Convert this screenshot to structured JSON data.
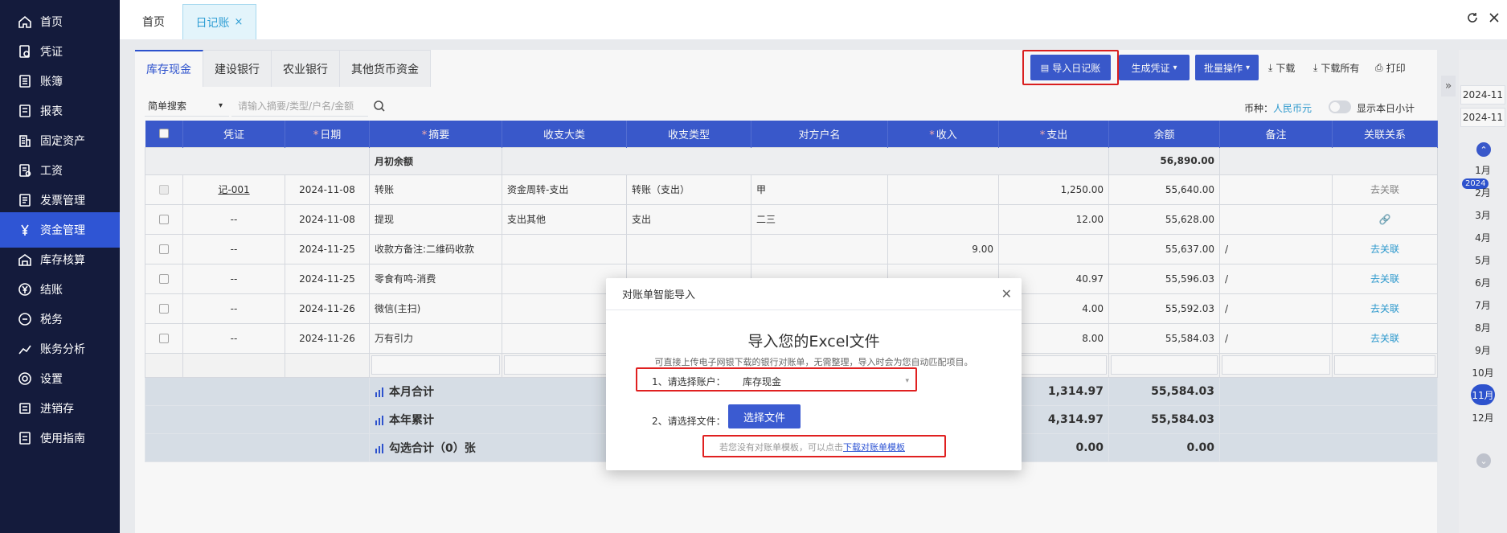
{
  "sidebar": {
    "items": [
      {
        "label": "首页",
        "icon": "home-icon"
      },
      {
        "label": "凭证",
        "icon": "voucher-icon"
      },
      {
        "label": "账簿",
        "icon": "ledger-icon"
      },
      {
        "label": "报表",
        "icon": "report-icon"
      },
      {
        "label": "固定资产",
        "icon": "building-icon"
      },
      {
        "label": "工资",
        "icon": "salary-icon"
      },
      {
        "label": "发票管理",
        "icon": "invoice-icon"
      },
      {
        "label": "资金管理",
        "icon": "yen-icon"
      },
      {
        "label": "库存核算",
        "icon": "warehouse-icon"
      },
      {
        "label": "结账",
        "icon": "yen-circle-icon"
      },
      {
        "label": "税务",
        "icon": "tax-icon"
      },
      {
        "label": "账务分析",
        "icon": "line-chart-icon"
      },
      {
        "label": "设置",
        "icon": "gear-icon"
      },
      {
        "label": "进销存",
        "icon": "inventory-icon"
      },
      {
        "label": "使用指南",
        "icon": "guide-icon"
      }
    ],
    "active_index": 7
  },
  "topbar": {
    "home_tab": "首页",
    "active_tab": "日记账",
    "close_glyph": "×"
  },
  "account_tabs": [
    "库存现金",
    "建设银行",
    "农业银行",
    "其他货币资金"
  ],
  "toolbar": {
    "import_label": "导入日记账",
    "generate_label": "生成凭证",
    "batch_label": "批量操作",
    "download_label": "下载",
    "download_all_label": "下载所有",
    "print_label": "打印"
  },
  "search": {
    "mode": "简单搜索",
    "placeholder": "请输入摘要/类型/户名/金额",
    "currency_label": "币种：",
    "currency_value": "人民币元",
    "daily_subtotal_label": "显示本日小计"
  },
  "table": {
    "headers": [
      "凭证",
      "日期",
      "摘要",
      "收支大类",
      "收支类型",
      "对方户名",
      "收入",
      "支出",
      "余额",
      "备注",
      "关联关系"
    ],
    "opening": {
      "label": "月初余额",
      "balance": "56,890.00"
    },
    "rows": [
      {
        "voucher": "记-001",
        "date": "2024-11-08",
        "summary": "转账",
        "category": "资金周转-支出",
        "type": "转账（支出）",
        "party": "甲",
        "income": "",
        "expense": "1,250.00",
        "balance": "55,640.00",
        "note": "",
        "relation": "去关联",
        "disabled": true
      },
      {
        "voucher": "--",
        "date": "2024-11-08",
        "summary": "提现",
        "category": "支出其他",
        "type": "支出",
        "party": "二三",
        "income": "",
        "expense": "12.00",
        "balance": "55,628.00",
        "note": "",
        "relation": "link-icon",
        "disabled": false
      },
      {
        "voucher": "--",
        "date": "2024-11-25",
        "summary": "收款方备注:二维码收款",
        "category": "",
        "type": "",
        "party": "",
        "income": "9.00",
        "expense": "",
        "balance": "55,637.00",
        "note": "/",
        "relation": "去关联",
        "disabled": false
      },
      {
        "voucher": "--",
        "date": "2024-11-25",
        "summary": "零食有鸣-消费",
        "category": "",
        "type": "",
        "party": "",
        "income": "",
        "expense": "40.97",
        "balance": "55,596.03",
        "note": "/",
        "relation": "去关联",
        "disabled": false
      },
      {
        "voucher": "--",
        "date": "2024-11-26",
        "summary": "微信(主扫)",
        "category": "",
        "type": "",
        "party": "",
        "income": "",
        "expense": "4.00",
        "balance": "55,592.03",
        "note": "/",
        "relation": "去关联",
        "disabled": false
      },
      {
        "voucher": "--",
        "date": "2024-11-26",
        "summary": "万有引力",
        "category": "",
        "type": "",
        "party": "",
        "income": "",
        "expense": "8.00",
        "balance": "55,584.03",
        "note": "/",
        "relation": "去关联",
        "disabled": false
      }
    ],
    "totals": [
      {
        "label": "本月合计",
        "expense": "1,314.97",
        "balance": "55,584.03"
      },
      {
        "label": "本年累计",
        "expense": "4,314.97",
        "balance": "55,584.03"
      },
      {
        "label": "勾选合计（0）张",
        "expense": "0.00",
        "balance": "0.00"
      }
    ]
  },
  "right_panel": {
    "dates": [
      "2024-11",
      "2024-11"
    ],
    "year": "2024",
    "months": [
      "1月",
      "2月",
      "3月",
      "4月",
      "5月",
      "6月",
      "7月",
      "8月",
      "9月",
      "10月",
      "11月",
      "12月"
    ],
    "active_month": "11月"
  },
  "modal": {
    "header": "对账单智能导入",
    "title": "导入您的Excel文件",
    "description": "可直接上传电子网银下载的银行对账单，无需整理，导入时会为您自动匹配项目。",
    "step1_label": "1、请选择账户：",
    "account_value": "库存现金",
    "step2_label": "2、请选择文件：",
    "choose_file": "选择文件",
    "template_note": "若您没有对账单模板，可以点击",
    "template_link": "下载对账单模板"
  },
  "colors": {
    "primary": "#3b5bd1",
    "sidebar": "#141b3c",
    "highlight": "#e02020",
    "link": "#2f9ed4"
  }
}
